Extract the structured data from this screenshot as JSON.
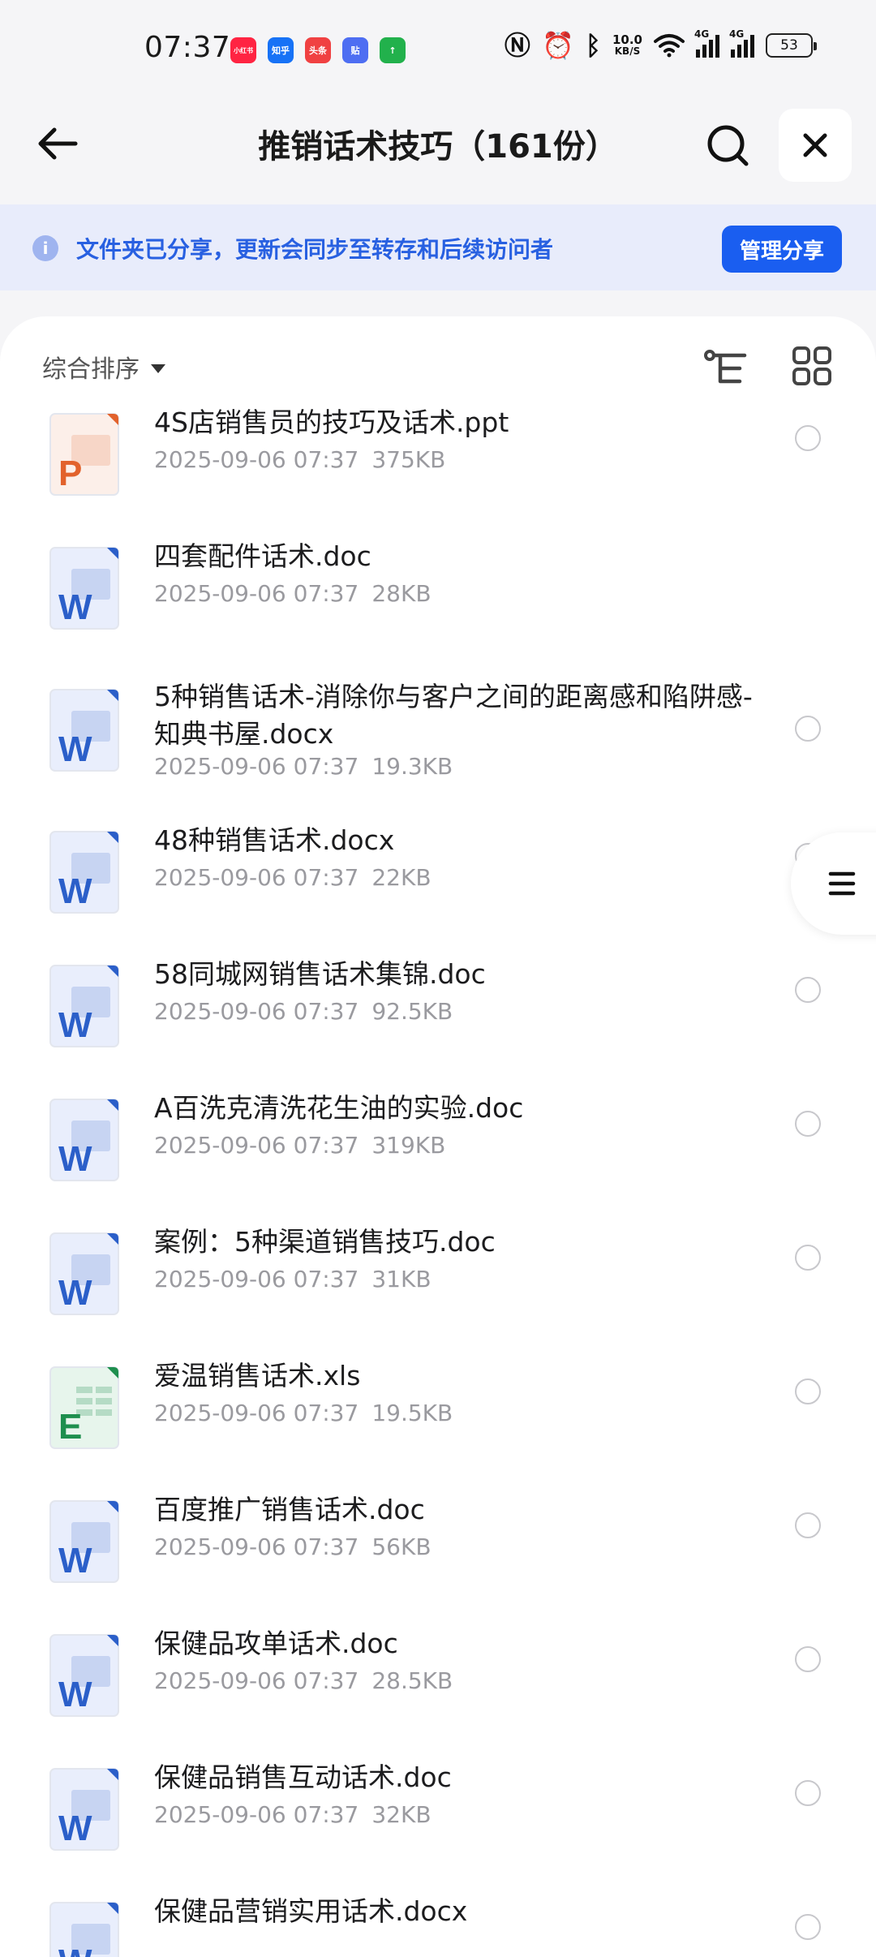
{
  "status_bar": {
    "time": "07:37",
    "app_icons": [
      {
        "label": "小红书",
        "color": "#ff2442"
      },
      {
        "label": "知乎",
        "color": "#1772f6"
      },
      {
        "label": "头条",
        "color": "#f04142"
      },
      {
        "label": "贴",
        "color": "#4e6ef2"
      },
      {
        "label": "↑",
        "color": "#22b14c"
      }
    ],
    "net_speed_value": "10.0",
    "net_speed_unit": "KB/S",
    "signal_label_1": "4G",
    "signal_label_2": "4G",
    "battery": "53"
  },
  "header": {
    "title": "推销话术技巧（161份）"
  },
  "banner": {
    "text": "文件夹已分享，更新会同步至转存和后续访问者",
    "manage_button": "管理分享"
  },
  "sortbar": {
    "sort_label": "综合排序"
  },
  "files": [
    {
      "name": "4S店销售员的技巧及话术.ppt",
      "date": "2025-09-06 07:37",
      "size": "375KB",
      "type": "ppt"
    },
    {
      "name": "四套配件话术.doc",
      "date": "2025-09-06 07:37",
      "size": "28KB",
      "type": "doc"
    },
    {
      "name": "5种销售话术-消除你与客户之间的距离感和陷阱感-知典书屋.docx",
      "date": "2025-09-06 07:37",
      "size": "19.3KB",
      "type": "doc"
    },
    {
      "name": "48种销售话术.docx",
      "date": "2025-09-06 07:37",
      "size": "22KB",
      "type": "doc"
    },
    {
      "name": "58同城网销售话术集锦.doc",
      "date": "2025-09-06 07:37",
      "size": "92.5KB",
      "type": "doc"
    },
    {
      "name": "A百洗克清洗花生油的实验.doc",
      "date": "2025-09-06 07:37",
      "size": "319KB",
      "type": "doc"
    },
    {
      "name": "案例：5种渠道销售技巧.doc",
      "date": "2025-09-06 07:37",
      "size": "31KB",
      "type": "doc"
    },
    {
      "name": "爱温销售话术.xls",
      "date": "2025-09-06 07:37",
      "size": "19.5KB",
      "type": "xls"
    },
    {
      "name": "百度推广销售话术.doc",
      "date": "2025-09-06 07:37",
      "size": "56KB",
      "type": "doc"
    },
    {
      "name": "保健品攻单话术.doc",
      "date": "2025-09-06 07:37",
      "size": "28.5KB",
      "type": "doc"
    },
    {
      "name": "保健品销售互动话术.doc",
      "date": "2025-09-06 07:37",
      "size": "32KB",
      "type": "doc"
    },
    {
      "name": "保健品营销实用话术.docx",
      "date": "",
      "size": "",
      "type": "doc"
    }
  ],
  "icons": {
    "back": "arrow-left-icon",
    "search": "search-icon",
    "close": "close-icon",
    "tree": "tree-view-icon",
    "grid": "grid-view-icon",
    "menu": "menu-icon",
    "info": "info-icon"
  },
  "colors": {
    "accent": "#1a5ef0",
    "banner_bg": "#e8ecfb",
    "banner_text": "#2860e1",
    "word": "#2b5fc9",
    "ppt": "#e2622c",
    "excel": "#1e8f4e"
  }
}
